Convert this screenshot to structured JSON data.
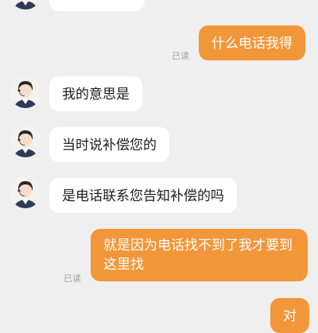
{
  "colors": {
    "background": "#efefef",
    "incoming_bubble": "#ffffff",
    "outgoing_bubble": "#f2963a",
    "outgoing_text": "#ffffff",
    "read_receipt": "#a2a2a2"
  },
  "messages": [
    {
      "sender": "agent",
      "text": ""
    },
    {
      "sender": "user",
      "text": "什么电话我得",
      "read_status": "已读"
    },
    {
      "sender": "agent",
      "text": "我的意思是"
    },
    {
      "sender": "agent",
      "text": "当时说补偿您的"
    },
    {
      "sender": "agent",
      "text": "是电话联系您告知补偿的吗"
    },
    {
      "sender": "user",
      "lines": [
        "就是因为电话找不到了我才要到",
        "这里找"
      ],
      "read_status": "已读"
    },
    {
      "sender": "user",
      "text": "对"
    }
  ],
  "avatar_icon": "customer-service-agent-avatar-icon"
}
